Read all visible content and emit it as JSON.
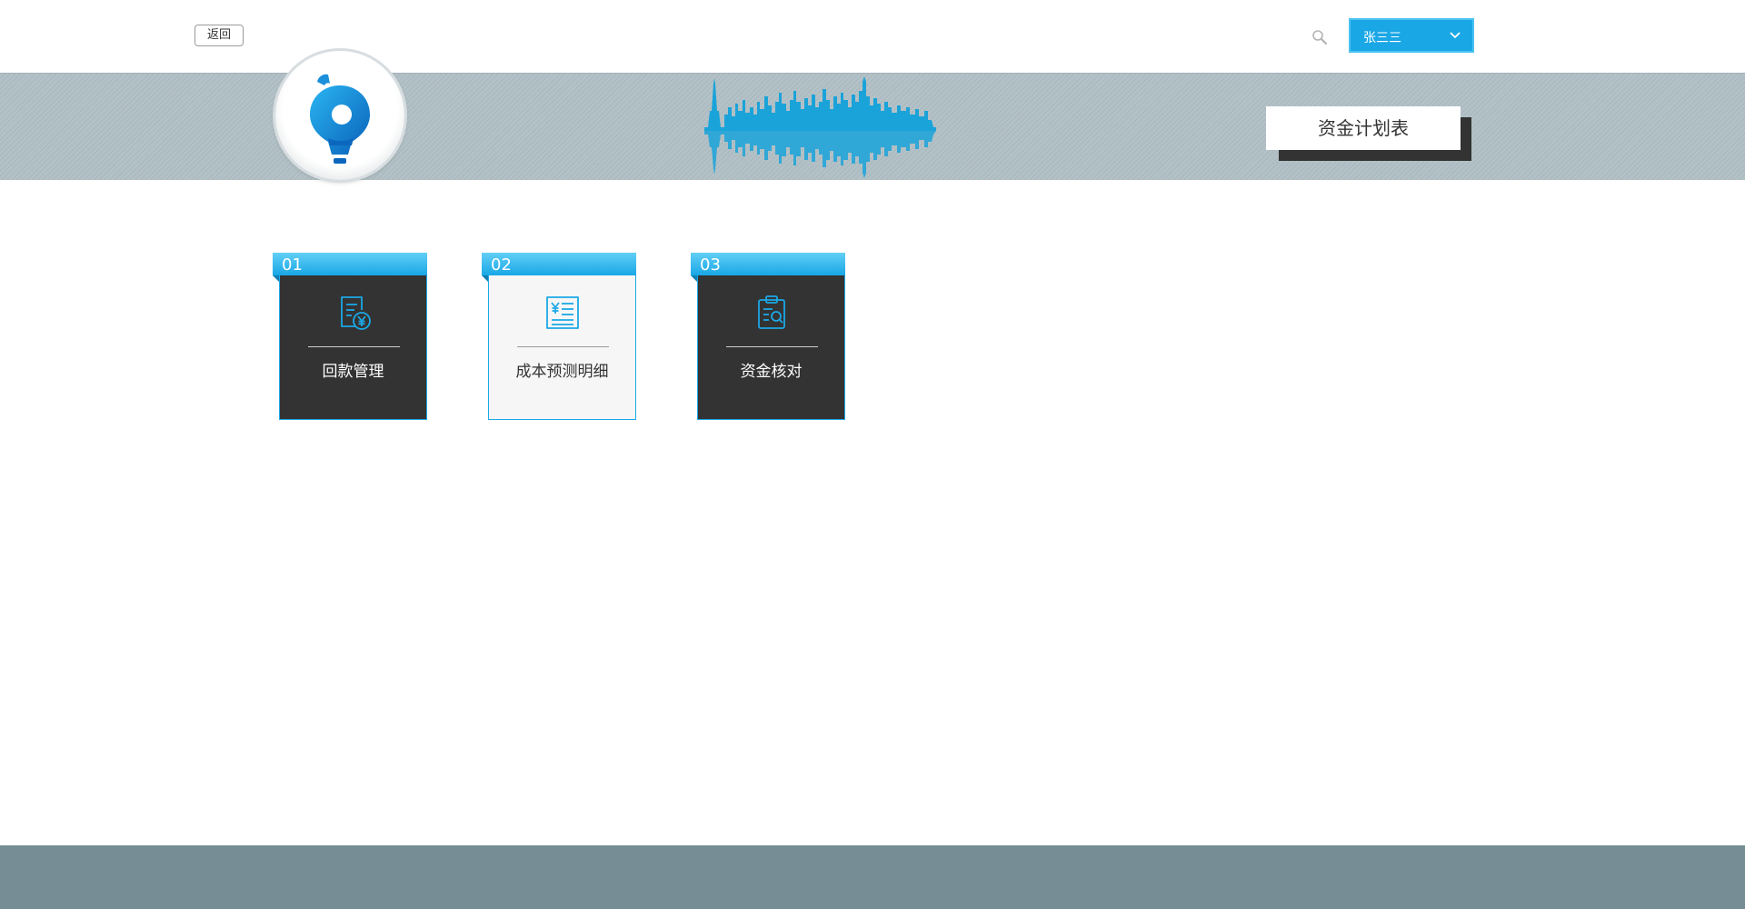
{
  "topbar": {
    "back_label": "返回",
    "user": {
      "name": "张三三",
      "accent": "#1aa7e6"
    }
  },
  "banner": {
    "title": "资金计划表",
    "background": "#b1c0c6",
    "skyline_color": "#1aa3d9"
  },
  "cards": [
    {
      "index": "01",
      "label": "回款管理",
      "icon": "receipt-yuan-icon",
      "theme": "dark"
    },
    {
      "index": "02",
      "label": "成本预测明细",
      "icon": "yuan-list-icon",
      "theme": "light"
    },
    {
      "index": "03",
      "label": "资金核对",
      "icon": "clipboard-search-icon",
      "theme": "dark"
    }
  ],
  "colors": {
    "accent": "#1aa7e6",
    "card_dark": "#333333",
    "card_light": "#f6f6f6",
    "footer": "#768d95"
  }
}
